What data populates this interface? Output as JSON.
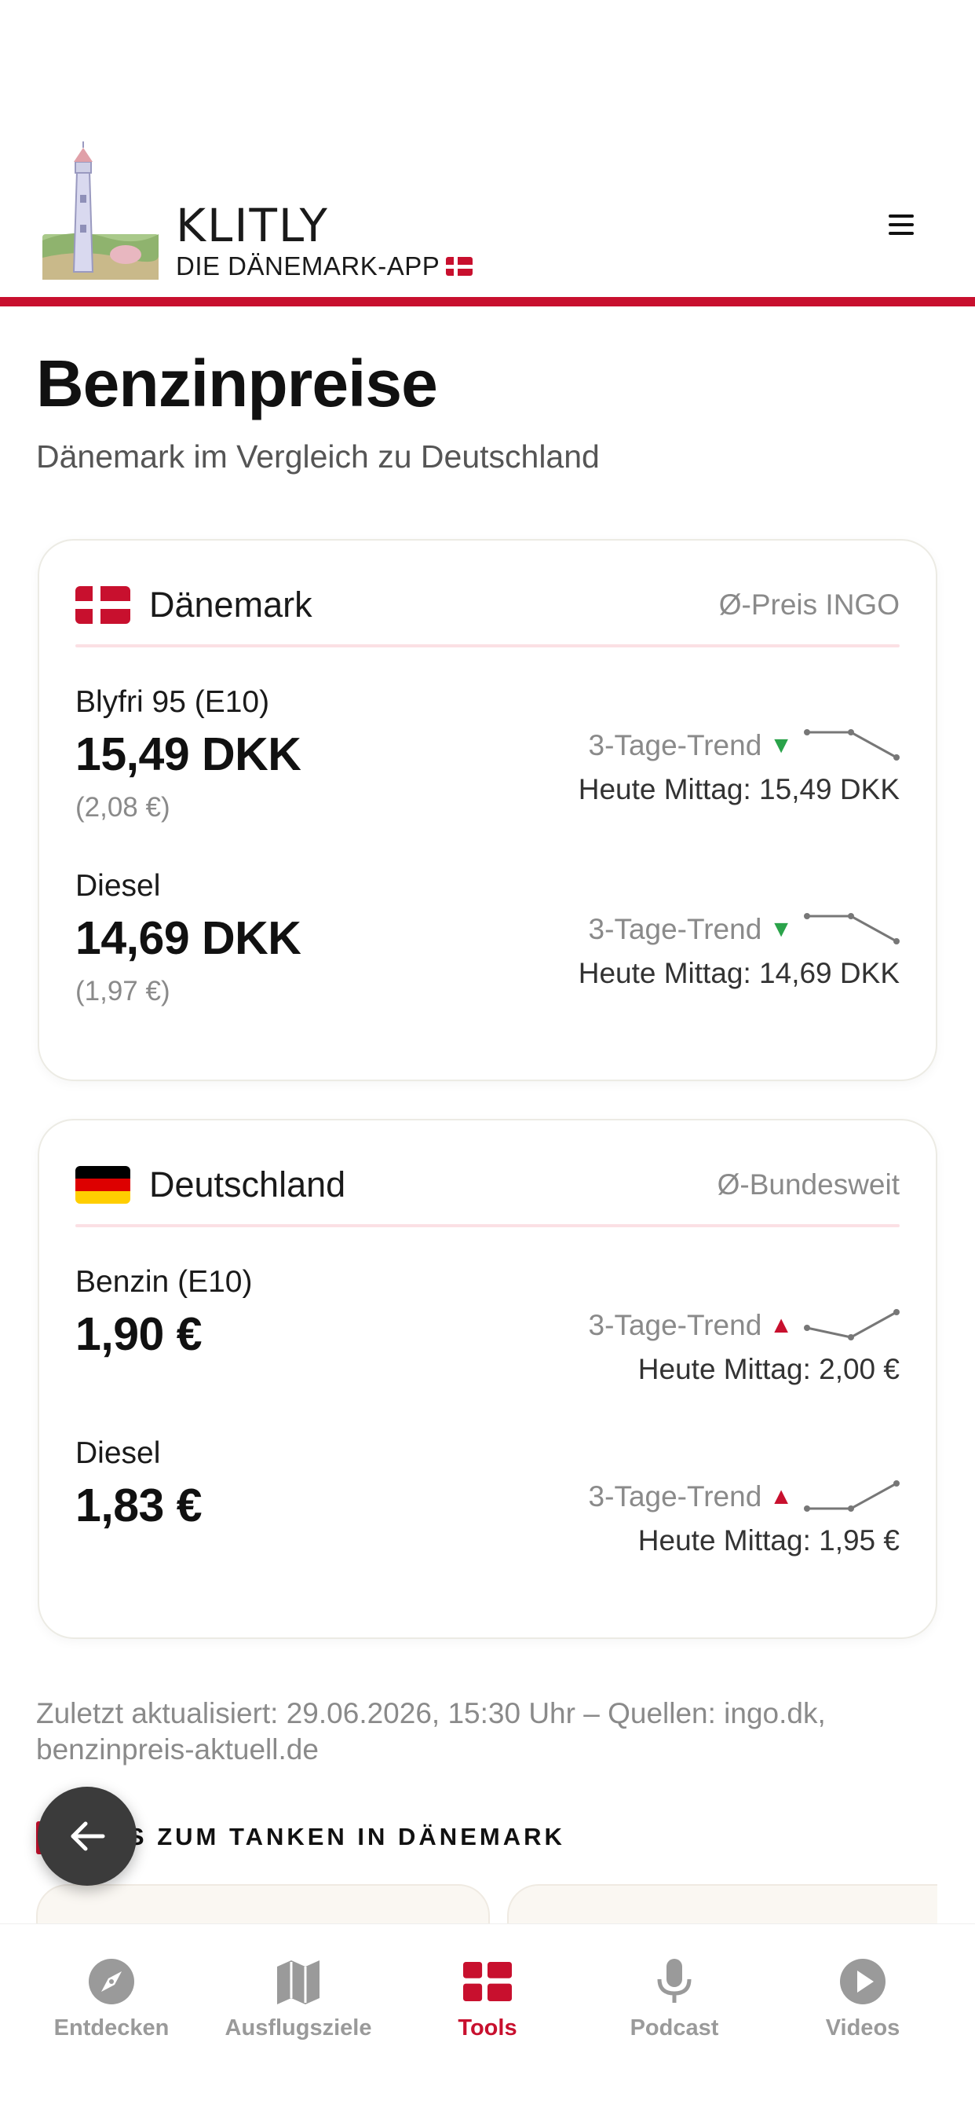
{
  "header": {
    "brand_name": "KLITLY",
    "brand_sub": "DIE DÄNEMARK-APP",
    "menu_icon": "hamburger-menu-icon",
    "accent_color": "#c8102e"
  },
  "page": {
    "title": "Benzinpreise",
    "subtitle": "Dänemark im Vergleich zu Deutschland"
  },
  "denmark": {
    "country": "Dänemark",
    "note": "Ø-Preis INGO",
    "flag_icon": "denmark-flag-icon",
    "fuels": [
      {
        "label": "Blyfri 95 (E10)",
        "price": "15,49 DKK",
        "euro": "(2,08 €)",
        "trend_label": "3-Tage-Trend",
        "trend_arrow": "▼",
        "trend_direction": "down",
        "noon": "Heute Mittag: 15,49 DKK"
      },
      {
        "label": "Diesel",
        "price": "14,69 DKK",
        "euro": "(1,97 €)",
        "trend_label": "3-Tage-Trend",
        "trend_arrow": "▼",
        "trend_direction": "down",
        "noon": "Heute Mittag: 14,69 DKK"
      }
    ]
  },
  "germany": {
    "country": "Deutschland",
    "note": "Ø-Bundesweit",
    "flag_icon": "germany-flag-icon",
    "fuels": [
      {
        "label": "Benzin (E10)",
        "price": "1,90 €",
        "trend_label": "3-Tage-Trend",
        "trend_arrow": "▲",
        "trend_direction": "up",
        "noon": "Heute Mittag: 2,00 €"
      },
      {
        "label": "Diesel",
        "price": "1,83 €",
        "trend_label": "3-Tage-Trend",
        "trend_arrow": "▲",
        "trend_direction": "up",
        "noon": "Heute Mittag: 1,95 €"
      }
    ]
  },
  "footer_note": "Zuletzt aktualisiert: 29.06.2026, 15:30 Uhr – Quellen: ingo.dk, benzinpreis-aktuell.de",
  "tips": {
    "title": "TIPPS ZUM TANKEN IN DÄNEMARK"
  },
  "back_button": {
    "icon": "arrow-left-icon"
  },
  "tabbar": {
    "tabs": [
      {
        "label": "Entdecken",
        "icon": "compass-icon",
        "active": false
      },
      {
        "label": "Ausflugsziele",
        "icon": "map-icon",
        "active": false
      },
      {
        "label": "Tools",
        "icon": "danish-flag-icon",
        "active": true
      },
      {
        "label": "Podcast",
        "icon": "microphone-icon",
        "active": false
      },
      {
        "label": "Videos",
        "icon": "play-icon",
        "active": false
      }
    ],
    "active_color": "#c8102e",
    "inactive_color": "#9a9a9a"
  }
}
